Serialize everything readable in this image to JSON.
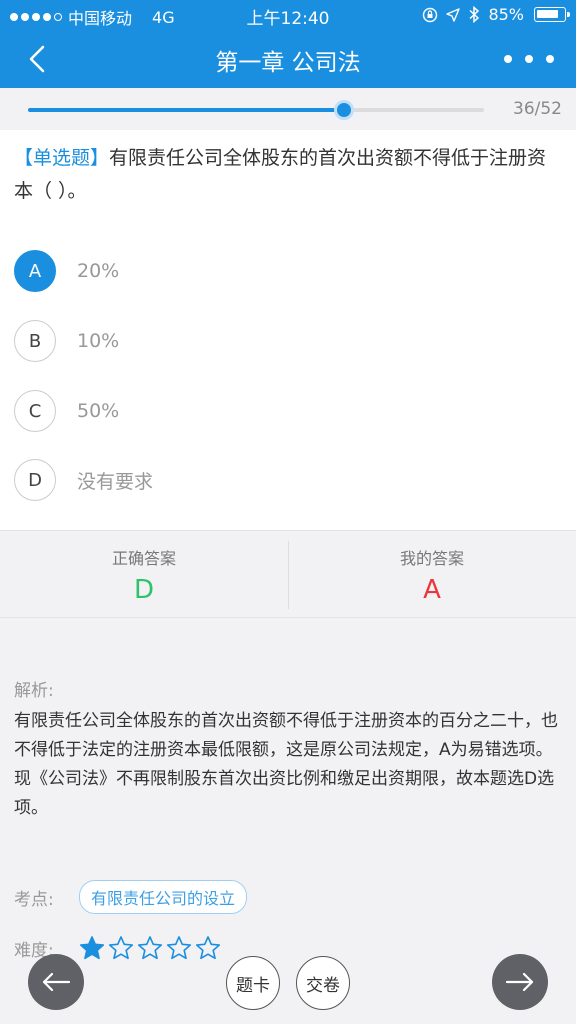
{
  "status_bar": {
    "carrier": "中国移动",
    "network": "4G",
    "time": "上午12:40",
    "battery": "85%",
    "battery_level": 0.85
  },
  "nav": {
    "title": "第一章 公司法",
    "back_icon": "chevron-left-icon",
    "more_icon": "more-dots-icon"
  },
  "progress": {
    "counter": "36/52",
    "current": 36,
    "total": 52
  },
  "question": {
    "type": "【单选题】",
    "text": "有限责任公司全体股东的首次出资额不得低于注册资本（ ）。"
  },
  "options": [
    {
      "key": "A",
      "text": "20%",
      "selected": true
    },
    {
      "key": "B",
      "text": "10%",
      "selected": false
    },
    {
      "key": "C",
      "text": "50%",
      "selected": false
    },
    {
      "key": "D",
      "text": "没有要求",
      "selected": false
    }
  ],
  "answers": {
    "correct_label": "正确答案",
    "correct_value": "D",
    "correct_color": "#2ec36b",
    "mine_label": "我的答案",
    "mine_value": "A",
    "mine_color": "#e8373e"
  },
  "analysis": {
    "label": "解析:",
    "text": "有限责任公司全体股东的首次出资额不得低于注册资本的百分之二十，也不得低于法定的注册资本最低限额，这是原公司法规定，A为易错选项。现《公司法》不再限制股东首次出资比例和缴足出资期限，故本题选D选项。"
  },
  "kaodian": {
    "label": "考点:",
    "tag": "有限责任公司的设立"
  },
  "difficulty": {
    "label": "难度:",
    "rating": 1,
    "max": 5
  },
  "footer": {
    "card_label": "题卡",
    "submit_label": "交卷",
    "prev_icon": "arrow-left-icon",
    "next_icon": "arrow-right-icon"
  },
  "colors": {
    "accent": "#1a8fe0"
  }
}
